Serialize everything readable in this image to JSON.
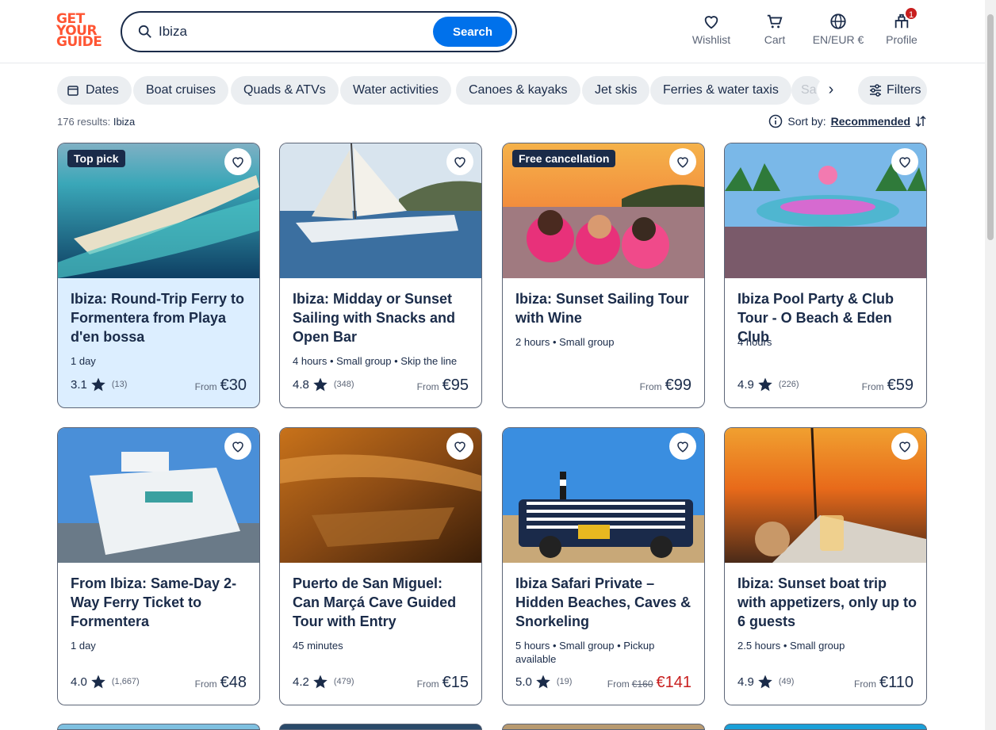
{
  "header": {
    "logo_lines": [
      "GET",
      "YOUR",
      "GUIDE"
    ],
    "search_value": "Ibiza",
    "search_button": "Search",
    "wishlist": "Wishlist",
    "cart": "Cart",
    "language": "EN/EUR €",
    "profile": "Profile",
    "profile_badge": "1"
  },
  "chips": {
    "dates": "Dates",
    "items": [
      "Boat cruises",
      "Quads & ATVs",
      "Water activities",
      "Canoes & kayaks",
      "Jet skis",
      "Ferries & water taxis"
    ],
    "faded": "Sa",
    "filters": "Filters"
  },
  "results": {
    "count": "176 results:",
    "query": "Ibiza"
  },
  "sort": {
    "label": "Sort by:",
    "value": "Recommended"
  },
  "cards": [
    {
      "tag": "Top pick",
      "title": "Ibiza: Round-Trip Ferry to Formentera from Playa d'en bossa",
      "meta": "1 day",
      "rating": "3.1",
      "count": "(13)",
      "from": "From",
      "price": "€30"
    },
    {
      "tag": "",
      "title": "Ibiza: Midday or Sunset Sailing with Snacks and Open Bar",
      "meta": "4 hours • Small group • Skip the line",
      "rating": "4.8",
      "count": "(348)",
      "from": "From",
      "price": "€95"
    },
    {
      "tag": "Free cancellation",
      "title": "Ibiza: Sunset Sailing Tour with Wine",
      "meta": "2 hours • Small group",
      "rating": "",
      "count": "",
      "from": "From",
      "price": "€99"
    },
    {
      "tag": "",
      "title": "Ibiza Pool Party & Club Tour - O Beach & Eden Club",
      "meta": "4 hours",
      "rating": "4.9",
      "count": "(226)",
      "from": "From",
      "price": "€59"
    },
    {
      "tag": "",
      "title": "From Ibiza: Same-Day 2-Way Ferry Ticket to Formentera",
      "meta": "1 day",
      "rating": "4.0",
      "count": "(1,667)",
      "from": "From",
      "price": "€48"
    },
    {
      "tag": "",
      "title": "Puerto de San Miguel: Can Marçá Cave Guided Tour with Entry",
      "meta": "45 minutes",
      "rating": "4.2",
      "count": "(479)",
      "from": "From",
      "price": "€15"
    },
    {
      "tag": "",
      "title": "Ibiza Safari Private – Hidden Beaches, Caves & Snorkeling",
      "meta": "5 hours • Small group • Pickup available",
      "rating": "5.0",
      "count": "(19)",
      "from": "From",
      "old_price": "€160",
      "price": "€141"
    },
    {
      "tag": "",
      "title": "Ibiza: Sunset boat trip with appetizers, only up to 6 guests",
      "meta": "2.5 hours • Small group",
      "rating": "4.9",
      "count": "(49)",
      "from": "From",
      "price": "€110"
    }
  ],
  "colors": {
    "brand": "#ff5533",
    "primary": "#0071eb",
    "text": "#1a2b49",
    "sale": "#c81e1e",
    "highlight": "#dceeff"
  }
}
